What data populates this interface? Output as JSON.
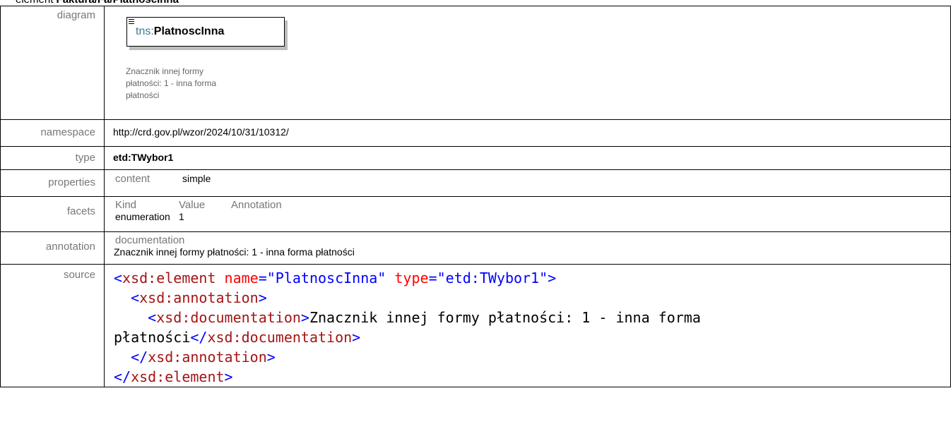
{
  "heading": {
    "prefix": "element",
    "path": "Faktura/Fa/PlatnoscInna"
  },
  "labels": {
    "diagram": "diagram",
    "namespace": "namespace",
    "type": "type",
    "properties": "properties",
    "facets": "facets",
    "annotation": "annotation",
    "source": "source"
  },
  "diagram": {
    "prefix": "tns:",
    "name": "PlatnoscInna",
    "doc_lines": [
      "Znacznik innej formy",
      "płatności: 1 - inna forma",
      "płatności"
    ]
  },
  "namespace": "http://crd.gov.pl/wzor/2024/10/31/10312/",
  "type": "etd:TWybor1",
  "properties": {
    "key": "content",
    "value": "simple"
  },
  "facets": {
    "headers": [
      "Kind",
      "Value",
      "Annotation"
    ],
    "rows": [
      {
        "kind": "enumeration",
        "value": "1",
        "annotation": ""
      }
    ]
  },
  "annotation": {
    "header": "documentation",
    "text": "Znacznik innej formy płatności: 1 - inna forma płatności"
  },
  "source": {
    "line1": {
      "open": "<",
      "el": "xsd:element",
      "attr1": " name",
      "eq1": "=",
      "val1": "\"PlatnoscInna\"",
      "attr2": " type",
      "eq2": "=",
      "val2": "\"etd:TWybor1\"",
      "close": ">"
    },
    "line2": {
      "indent": "  ",
      "open": "<",
      "el": "xsd:annotation",
      "close": ">"
    },
    "line3": {
      "indent": "    ",
      "open": "<",
      "el": "xsd:documentation",
      "close": ">",
      "text": "Znacznik innej formy płatności: 1 - inna forma"
    },
    "line4": {
      "text": "płatności",
      "open": "</",
      "el": "xsd:documentation",
      "close": ">"
    },
    "line5": {
      "indent": "  ",
      "open": "</",
      "el": "xsd:annotation",
      "close": ">"
    },
    "line6": {
      "open": "</",
      "el": "xsd:element",
      "close": ">"
    }
  }
}
